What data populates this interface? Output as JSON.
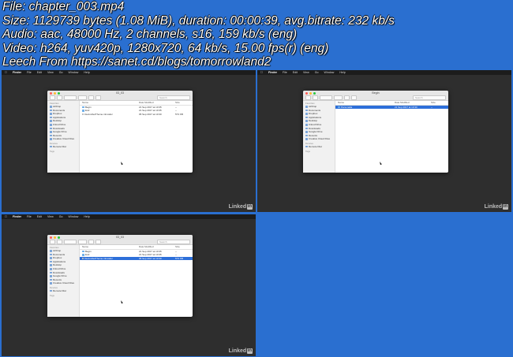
{
  "info": {
    "file": "File: chapter_003.mp4",
    "size": "Size: 1129739 bytes (1.08 MiB), duration: 00:00:39, avg.bitrate: 232 kb/s",
    "audio": "Audio: aac, 48000 Hz, 2 channels, s16, 159 kb/s (eng)",
    "video": "Video: h264, yuv420p, 1280x720, 64 kb/s, 15.00 fps(r) (eng)",
    "leech": "Leech From https://sanet.cd/blogs/tomorrowland2"
  },
  "menubar": [
    "Finder",
    "File",
    "Edit",
    "View",
    "Go",
    "Window",
    "Help"
  ],
  "linkedin": {
    "word": "Linked",
    "badge": "in"
  },
  "sidebar": {
    "favorites": "Favorites",
    "items": [
      "AirDrop",
      "Documents",
      "Dropbox",
      "Applications",
      "Desktop",
      "iCloud Drive",
      "Downloads",
      "Google Drive",
      "Recents",
      "Creative Cloud Files"
    ],
    "devices": "Devices",
    "device_items": [
      "Remote Disc"
    ],
    "tags": "Tags"
  },
  "columns": {
    "name": "Name",
    "date": "Date Modified",
    "size": "Size"
  },
  "search_placeholder": "Search",
  "frames": [
    {
      "title": "03_03",
      "rows": [
        {
          "name": "Begin",
          "date": "21 Sep 2017 at 10:35",
          "size": "--",
          "type": "folder"
        },
        {
          "name": "End",
          "date": "21 Sep 2017 at 10:35",
          "size": "--",
          "type": "folder"
        },
        {
          "name": "DeviceSetTheme.mlmodel",
          "date": "05 Sep 2017 at 10:30",
          "size": "573 KB",
          "type": "file"
        }
      ],
      "selected": -1
    },
    {
      "title": "Begin",
      "rows": [
        {
          "name": "Personalia",
          "date": "21 Sep 2017 at 10:30",
          "size": "--",
          "type": "folder"
        }
      ],
      "selected": 0
    },
    {
      "title": "03_03",
      "rows": [
        {
          "name": "Begin",
          "date": "21 Sep 2017 at 10:35",
          "size": "--",
          "type": "folder"
        },
        {
          "name": "End",
          "date": "21 Sep 2017 at 10:35",
          "size": "--",
          "type": "folder"
        },
        {
          "name": "DeviceSetTheme.mlmodel",
          "date": "05 Sep 2017 at 10:30",
          "size": "573 KB",
          "type": "file"
        }
      ],
      "selected": 2
    }
  ]
}
